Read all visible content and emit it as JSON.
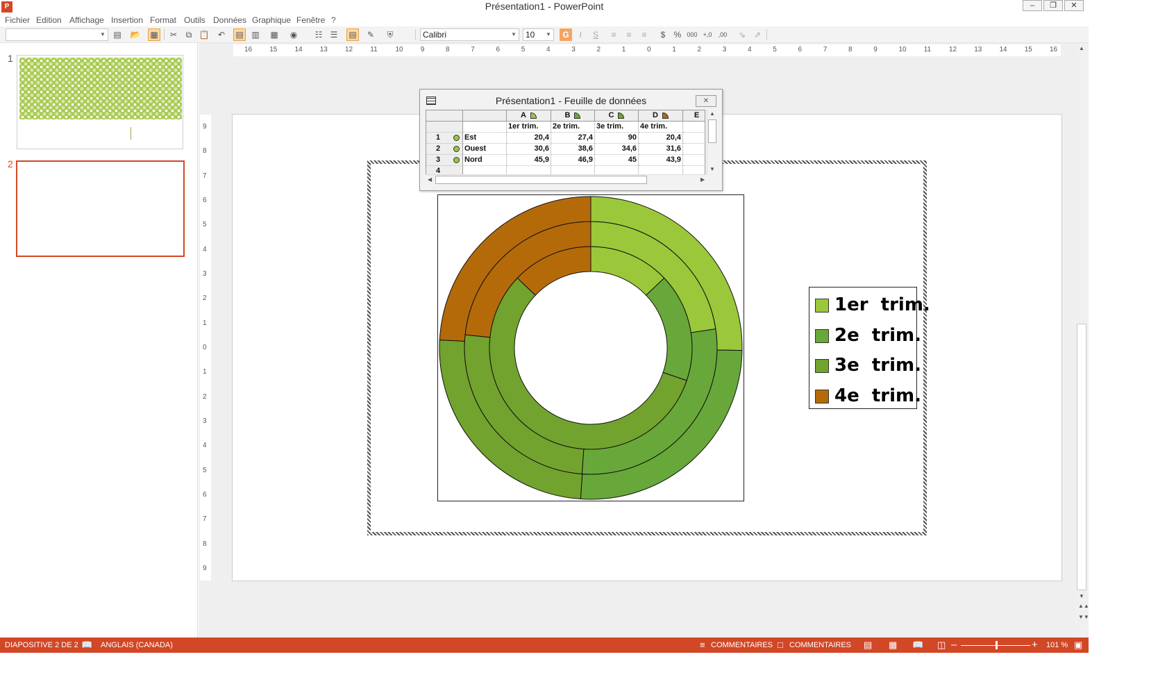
{
  "window": {
    "title": "Présentation1 - PowerPoint",
    "app_icon": "P",
    "controls": {
      "minimize": "–",
      "restore": "❐",
      "close": "✕"
    }
  },
  "menu": [
    "Fichier",
    "Edition",
    "Affichage",
    "Insertion",
    "Format",
    "Outils",
    "Données",
    "Graphique",
    "Fenêtre",
    "?"
  ],
  "toolbar": {
    "chart_object_combo": "",
    "font_name": "Calibri",
    "font_size": "10",
    "bold": "G",
    "italic": "I",
    "strike": "S",
    "currency": "$",
    "percent": "%",
    "thousands": "000",
    "increase_decimal": "+,0",
    "decrease_decimal": ",00"
  },
  "thumbnails": {
    "slide1_number": "1",
    "slide2_number": "2"
  },
  "rulers": {
    "horizontal": [
      "16",
      "15",
      "14",
      "13",
      "12",
      "11",
      "10",
      "9",
      "8",
      "7",
      "6",
      "5",
      "4",
      "3",
      "2",
      "1",
      "0",
      "1",
      "2",
      "3",
      "4",
      "5",
      "6",
      "7",
      "8",
      "9",
      "10",
      "11",
      "12",
      "13",
      "14",
      "15",
      "16"
    ],
    "vertical": [
      "9",
      "8",
      "7",
      "6",
      "5",
      "4",
      "3",
      "2",
      "1",
      "0",
      "1",
      "2",
      "3",
      "4",
      "5",
      "6",
      "7",
      "8",
      "9"
    ]
  },
  "datasheet": {
    "title": "Présentation1 - Feuille de données",
    "close": "✕",
    "columns": [
      "A",
      "B",
      "C",
      "D",
      "E"
    ],
    "headers": [
      "1er  trim.",
      "2e  trim.",
      "3e  trim.",
      "4e  trim."
    ],
    "rows": [
      {
        "num": "1",
        "label": "Est",
        "values": [
          "20,4",
          "27,4",
          "90",
          "20,4"
        ]
      },
      {
        "num": "2",
        "label": "Ouest",
        "values": [
          "30,6",
          "38,6",
          "34,6",
          "31,6"
        ]
      },
      {
        "num": "3",
        "label": "Nord",
        "values": [
          "45,9",
          "46,9",
          "45",
          "43,9"
        ]
      },
      {
        "num": "4",
        "label": "",
        "values": [
          "",
          "",
          "",
          ""
        ]
      }
    ]
  },
  "chart_data": {
    "type": "doughnut",
    "categories": [
      "1er  trim.",
      "2e  trim.",
      "3e  trim.",
      "4e  trim."
    ],
    "series": [
      {
        "name": "Est",
        "values": [
          20.4,
          27.4,
          90,
          20.4
        ]
      },
      {
        "name": "Ouest",
        "values": [
          30.6,
          38.6,
          34.6,
          31.6
        ]
      },
      {
        "name": "Nord",
        "values": [
          45.9,
          46.9,
          45,
          43.9
        ]
      }
    ],
    "ring_order": "Est inner, Nord outer",
    "colors": [
      "#9ac83a",
      "#68a83a",
      "#72a32e",
      "#b56a0a"
    ],
    "legend_position": "right"
  },
  "statusbar": {
    "slide_info": "DIAPOSITIVE 2 DE 2",
    "language": "ANGLAIS (CANADA)",
    "notes": "COMMENTAIRES",
    "comments": "COMMENTAIRES",
    "zoom": "101 %"
  }
}
